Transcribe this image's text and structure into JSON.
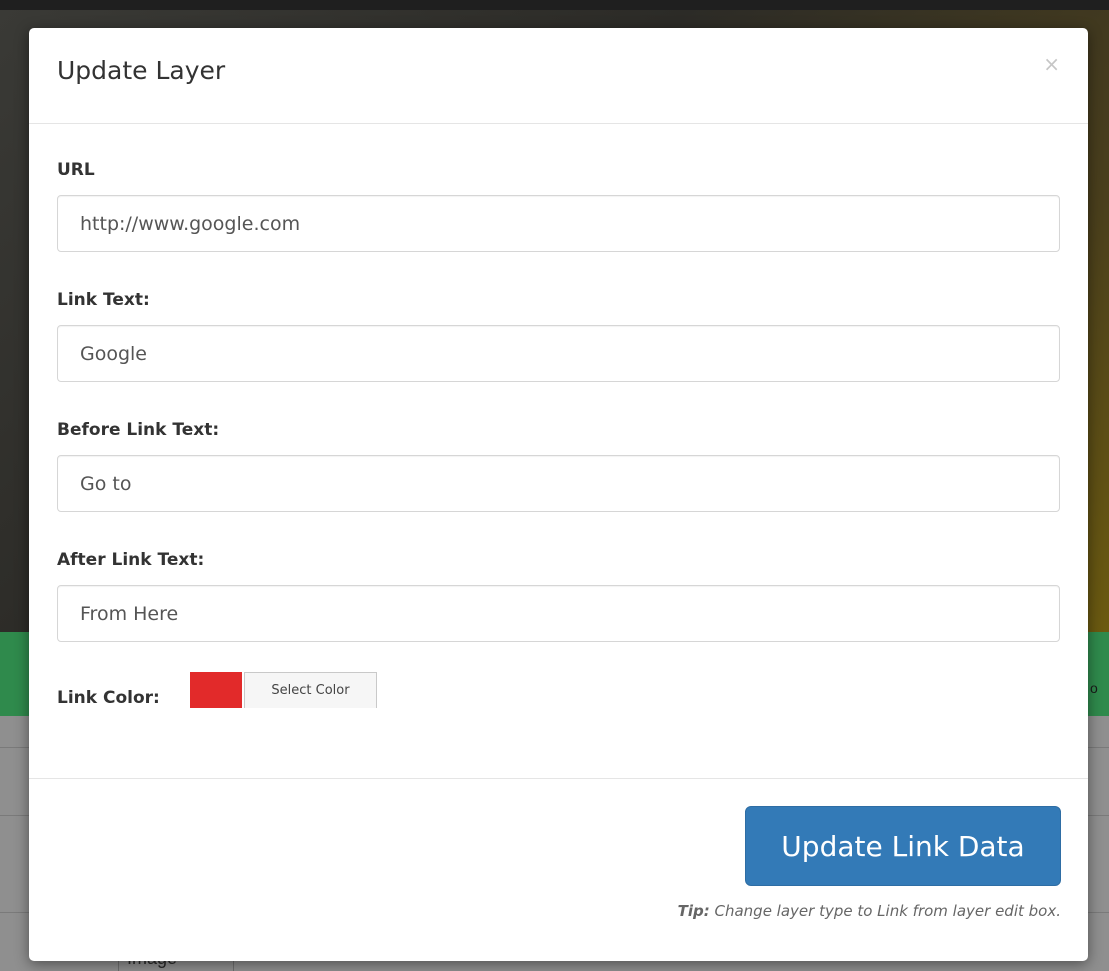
{
  "modal": {
    "title": "Update Layer",
    "close_glyph": "×",
    "fields": [
      {
        "label": "URL",
        "value": "http://www.google.com"
      },
      {
        "label": "Link Text:",
        "value": "Google"
      },
      {
        "label": "Before Link Text:",
        "value": "Go to"
      },
      {
        "label": "After Link Text:",
        "value": "From Here"
      }
    ],
    "link_color": {
      "label": "Link Color:",
      "swatch_color": "#e22a2a",
      "button_label": "Select Color"
    },
    "submit_label": "Update Link Data",
    "tip": {
      "prefix": "Tip:",
      "text": " Change layer type to Link from layer edit box."
    }
  },
  "background": {
    "right_fragment": "o",
    "bottom_cell": "Image"
  }
}
